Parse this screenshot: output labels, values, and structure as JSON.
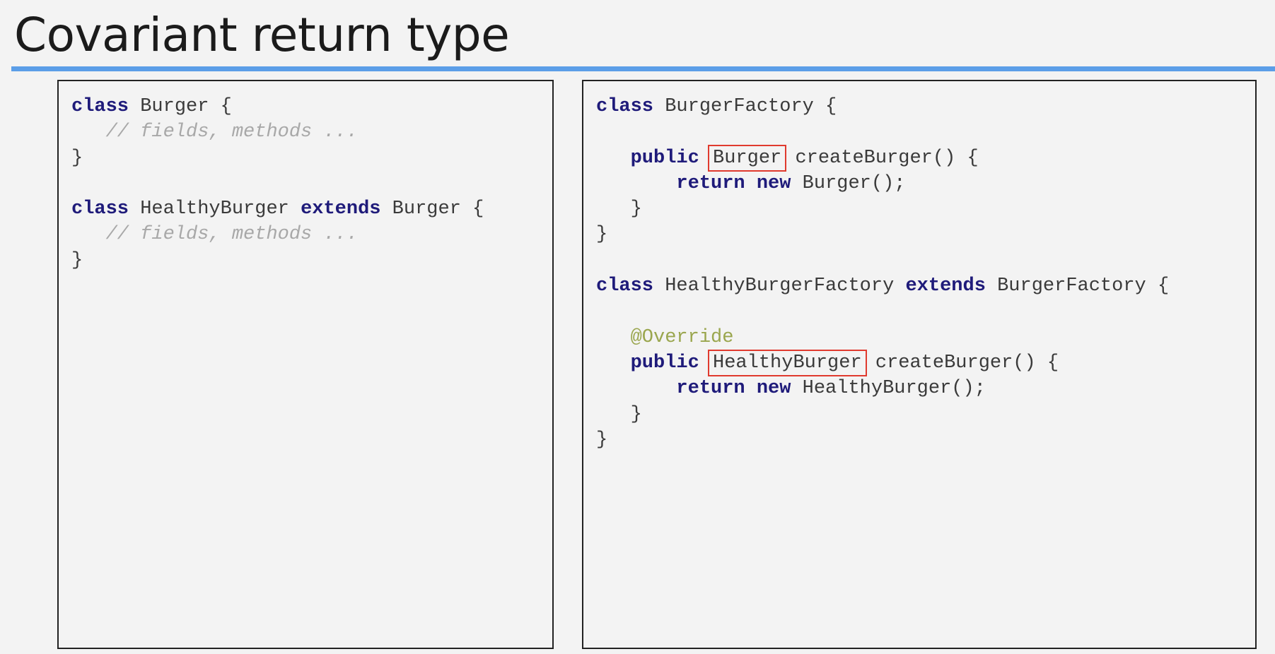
{
  "slide": {
    "title": "Covariant return type"
  },
  "left_code": [
    [
      {
        "t": "class",
        "c": "kw"
      },
      {
        "t": " Burger {"
      }
    ],
    [
      {
        "t": "   "
      },
      {
        "t": "// fields, methods ...",
        "c": "cm"
      }
    ],
    [
      {
        "t": "}"
      }
    ],
    [],
    [
      {
        "t": "class",
        "c": "kw"
      },
      {
        "t": " HealthyBurger "
      },
      {
        "t": "extends",
        "c": "kw"
      },
      {
        "t": " Burger {"
      }
    ],
    [
      {
        "t": "   "
      },
      {
        "t": "// fields, methods ...",
        "c": "cm"
      }
    ],
    [
      {
        "t": "}"
      }
    ]
  ],
  "right_code": [
    [
      {
        "t": "class",
        "c": "kw"
      },
      {
        "t": " BurgerFactory {"
      }
    ],
    [],
    [
      {
        "t": "   "
      },
      {
        "t": "public",
        "c": "kw"
      },
      {
        "t": " "
      },
      {
        "t": "Burger",
        "c": "hl"
      },
      {
        "t": " createBurger() {"
      }
    ],
    [
      {
        "t": "       "
      },
      {
        "t": "return",
        "c": "kw"
      },
      {
        "t": " "
      },
      {
        "t": "new",
        "c": "kw"
      },
      {
        "t": " Burger();"
      }
    ],
    [
      {
        "t": "   }"
      }
    ],
    [
      {
        "t": "}"
      }
    ],
    [],
    [
      {
        "t": "class",
        "c": "kw"
      },
      {
        "t": " HealthyBurgerFactory "
      },
      {
        "t": "extends",
        "c": "kw"
      },
      {
        "t": " BurgerFactory {"
      }
    ],
    [],
    [
      {
        "t": "   "
      },
      {
        "t": "@Override",
        "c": "an"
      }
    ],
    [
      {
        "t": "   "
      },
      {
        "t": "public",
        "c": "kw"
      },
      {
        "t": " "
      },
      {
        "t": "HealthyBurger",
        "c": "hl"
      },
      {
        "t": " createBurger() {"
      }
    ],
    [
      {
        "t": "       "
      },
      {
        "t": "return",
        "c": "kw"
      },
      {
        "t": " "
      },
      {
        "t": "new",
        "c": "kw"
      },
      {
        "t": " HealthyBurger();"
      }
    ],
    [
      {
        "t": "   }"
      }
    ],
    [
      {
        "t": "}"
      }
    ]
  ],
  "colors": {
    "keyword": "#1f1b7a",
    "comment": "#a8a8a8",
    "annotation": "#9aa64e",
    "highlight_box": "#e03a2e",
    "title_rule": "#5b9ee8",
    "background": "#f3f3f3"
  }
}
